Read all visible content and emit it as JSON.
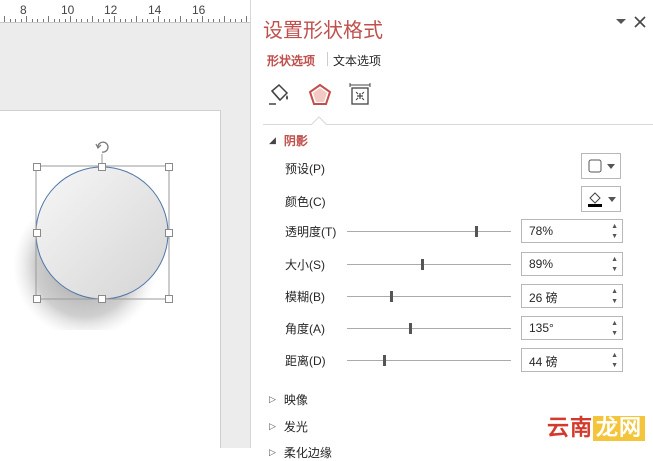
{
  "ruler": {
    "numbers": [
      "8",
      "10",
      "12",
      "14",
      "16"
    ]
  },
  "panel": {
    "title": "设置形状格式",
    "tabs": [
      "形状选项",
      "文本选项"
    ],
    "icons": [
      "fill-line-icon",
      "effects-icon",
      "size-properties-icon"
    ],
    "shadow_section": "阴影",
    "preset_label": "预设(P)",
    "color_label": "颜色(C)",
    "sliders": [
      {
        "label": "透明度(T)",
        "value": "78%",
        "fraction": 0.78
      },
      {
        "label": "大小(S)",
        "value": "89%",
        "fraction": 0.45
      },
      {
        "label": "模糊(B)",
        "value": "26 磅",
        "fraction": 0.26
      },
      {
        "label": "角度(A)",
        "value": "135°",
        "fraction": 0.375
      },
      {
        "label": "距离(D)",
        "value": "44 磅",
        "fraction": 0.22
      }
    ],
    "collapsed_sections": [
      "映像",
      "发光",
      "柔化边缘"
    ]
  },
  "watermark": {
    "part1": "云南",
    "part2": "龙网"
  },
  "colors": {
    "accent": "#c0504d"
  }
}
